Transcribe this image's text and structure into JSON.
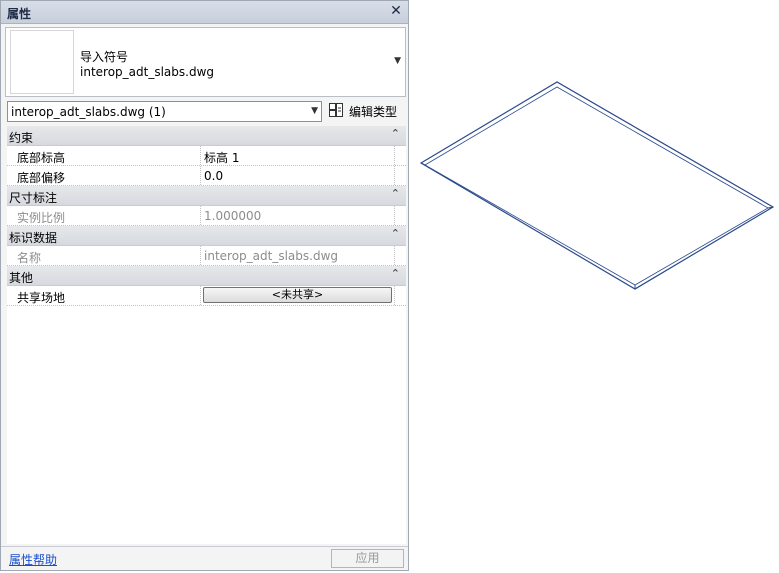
{
  "palette": {
    "title": "属性",
    "close_glyph": "✕",
    "type": {
      "family": "导入符号",
      "name": "interop_adt_slabs.dwg"
    },
    "selector_value": "interop_adt_slabs.dwg (1)",
    "edit_type_label": "编辑类型",
    "groups": {
      "constraints": {
        "label": "约束",
        "rows": [
          {
            "name": "底部标高",
            "value": "标高 1"
          },
          {
            "name": "底部偏移",
            "value": "0.0"
          }
        ]
      },
      "dimensions": {
        "label": "尺寸标注",
        "rows": [
          {
            "name": "实例比例",
            "value": "1.000000"
          }
        ]
      },
      "identity": {
        "label": "标识数据",
        "rows": [
          {
            "name": "名称",
            "value": "interop_adt_slabs.dwg"
          }
        ]
      },
      "other": {
        "label": "其他",
        "rows": [
          {
            "name": "共享场地",
            "value": "<未共享>"
          }
        ]
      }
    },
    "help_link": "属性帮助",
    "apply_label": "应用"
  },
  "colors": {
    "slab_outline": "#2b4a8c",
    "link": "#1a4fc9"
  }
}
